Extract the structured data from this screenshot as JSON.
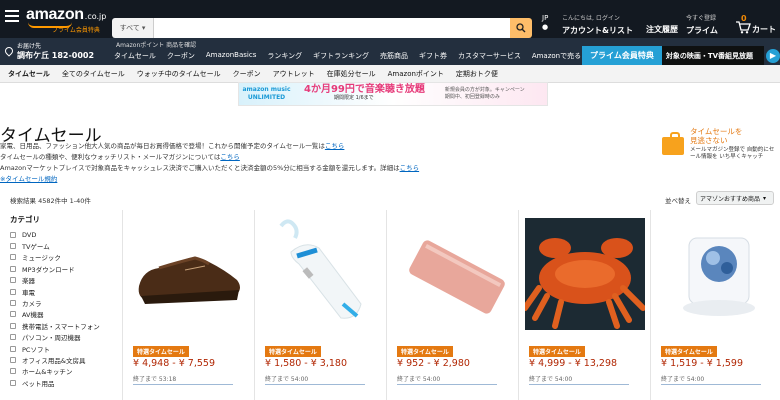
{
  "header": {
    "logo": "amazon",
    "logo_suffix": ".co.jp",
    "logo_sub": "プライム会員特典",
    "search": {
      "category": "すべて",
      "placeholder": ""
    },
    "lang": "JP",
    "account_small": "こんにちは, ログイン",
    "account_big": "アカウント&リスト",
    "orders": "注文履歴",
    "prime_small": "今すぐ登録",
    "prime_big": "プライム",
    "cart_count": "0",
    "cart_label": "カート"
  },
  "navbar": {
    "deliver_small": "お届け先",
    "deliver_addr": "調布ケ丘 182-0002",
    "promo": "Amazonポイント  商品を確認",
    "links": [
      "タイムセール",
      "クーポン",
      "AmazonBasics",
      "ランキング",
      "ギフトランキング",
      "売筋商品",
      "ギフト券",
      "カスタマーサービス",
      "Amazonで売る"
    ],
    "prime_banner": "プライム会員特典",
    "prime_banner_right": "対象の映画・TV番組見放題"
  },
  "subnav": [
    "タイムセール",
    "全てのタイムセール",
    "ウォッチ中のタイムセール",
    "クーポン",
    "アウトレット",
    "在庫処分セール",
    "Amazonポイント",
    "定期おトク便"
  ],
  "ad": {
    "brand": "amazon music",
    "brand2": "UNLIMITED",
    "message": "4か月99円で音楽聴き放題",
    "note": "期間限定 1/6まで",
    "sub": "新規会員の方が対象。キャンペーン期間中、初回登録時のみ"
  },
  "page": {
    "title": "タイムセール",
    "desc1": "家電、日用品、ファッション他大人気の商品が毎日お買得価格で登場！これから開催予定のタイムセール一覧は",
    "desc1_link": "こちら",
    "desc2": "タイムセールの種類や、便利なウォッチリスト・メールマガジンについては",
    "desc2_link": "こちら",
    "desc3": "Amazonマーケットプレイスで対象商品をキャッシュレス決済でご購入いただくと決済金額の5%分に相当する金額を還元します。詳細は",
    "desc3_link": "こちら",
    "rules_link": "※タイムセール規約",
    "results": "検索結果 4582件中 1-40件",
    "sort_label": "並べ替え",
    "sort_value": "アマゾンおすすめ商品"
  },
  "rightpromo": {
    "heading1": "タイムセールを",
    "heading2": "見逃さない",
    "sub": "メールマガジン登録で 自動的にセール情報を いち早くキャッチ"
  },
  "sidebar": {
    "heading": "カテゴリ",
    "items": [
      "DVD",
      "TVゲーム",
      "ミュージック",
      "MP3ダウンロード",
      "楽器",
      "車電",
      "カメラ",
      "AV機器",
      "携帯電話・スマートフォン",
      "パソコン・周辺機器",
      "PCソフト",
      "オフィス用品&文房具",
      "ホーム&キッチン",
      "ペット用品"
    ]
  },
  "products": [
    {
      "name": "leather-shoe",
      "badge": "特選タイムセール",
      "price": "¥ 4,948 - ¥ 7,559",
      "ends": "終了まで 53:18"
    },
    {
      "name": "humidifier",
      "badge": "特選タイムセール",
      "price": "¥ 1,580 - ¥ 3,180",
      "ends": "終了まで 54:00"
    },
    {
      "name": "power-bank",
      "badge": "特選タイムセール",
      "price": "¥ 952 - ¥ 2,980",
      "ends": "終了まで 54:00"
    },
    {
      "name": "crab",
      "badge": "特選タイムセール",
      "price": "¥ 4,999 - ¥ 13,298",
      "ends": "終了まで 54:00"
    },
    {
      "name": "lamp-speaker",
      "badge": "特選タイムセール",
      "price": "¥ 1,519 - ¥ 1,599",
      "ends": "終了まで 54:00"
    }
  ],
  "colors": {
    "header": "#131921",
    "nav": "#232f3e",
    "accent": "#ff9900",
    "price": "#b12704",
    "badge": "#e47911",
    "link": "#0066c0"
  },
  "icons": [
    "menu-icon",
    "search-icon",
    "cart-icon",
    "location-pin-icon",
    "flag-icon",
    "lock-icon"
  ]
}
